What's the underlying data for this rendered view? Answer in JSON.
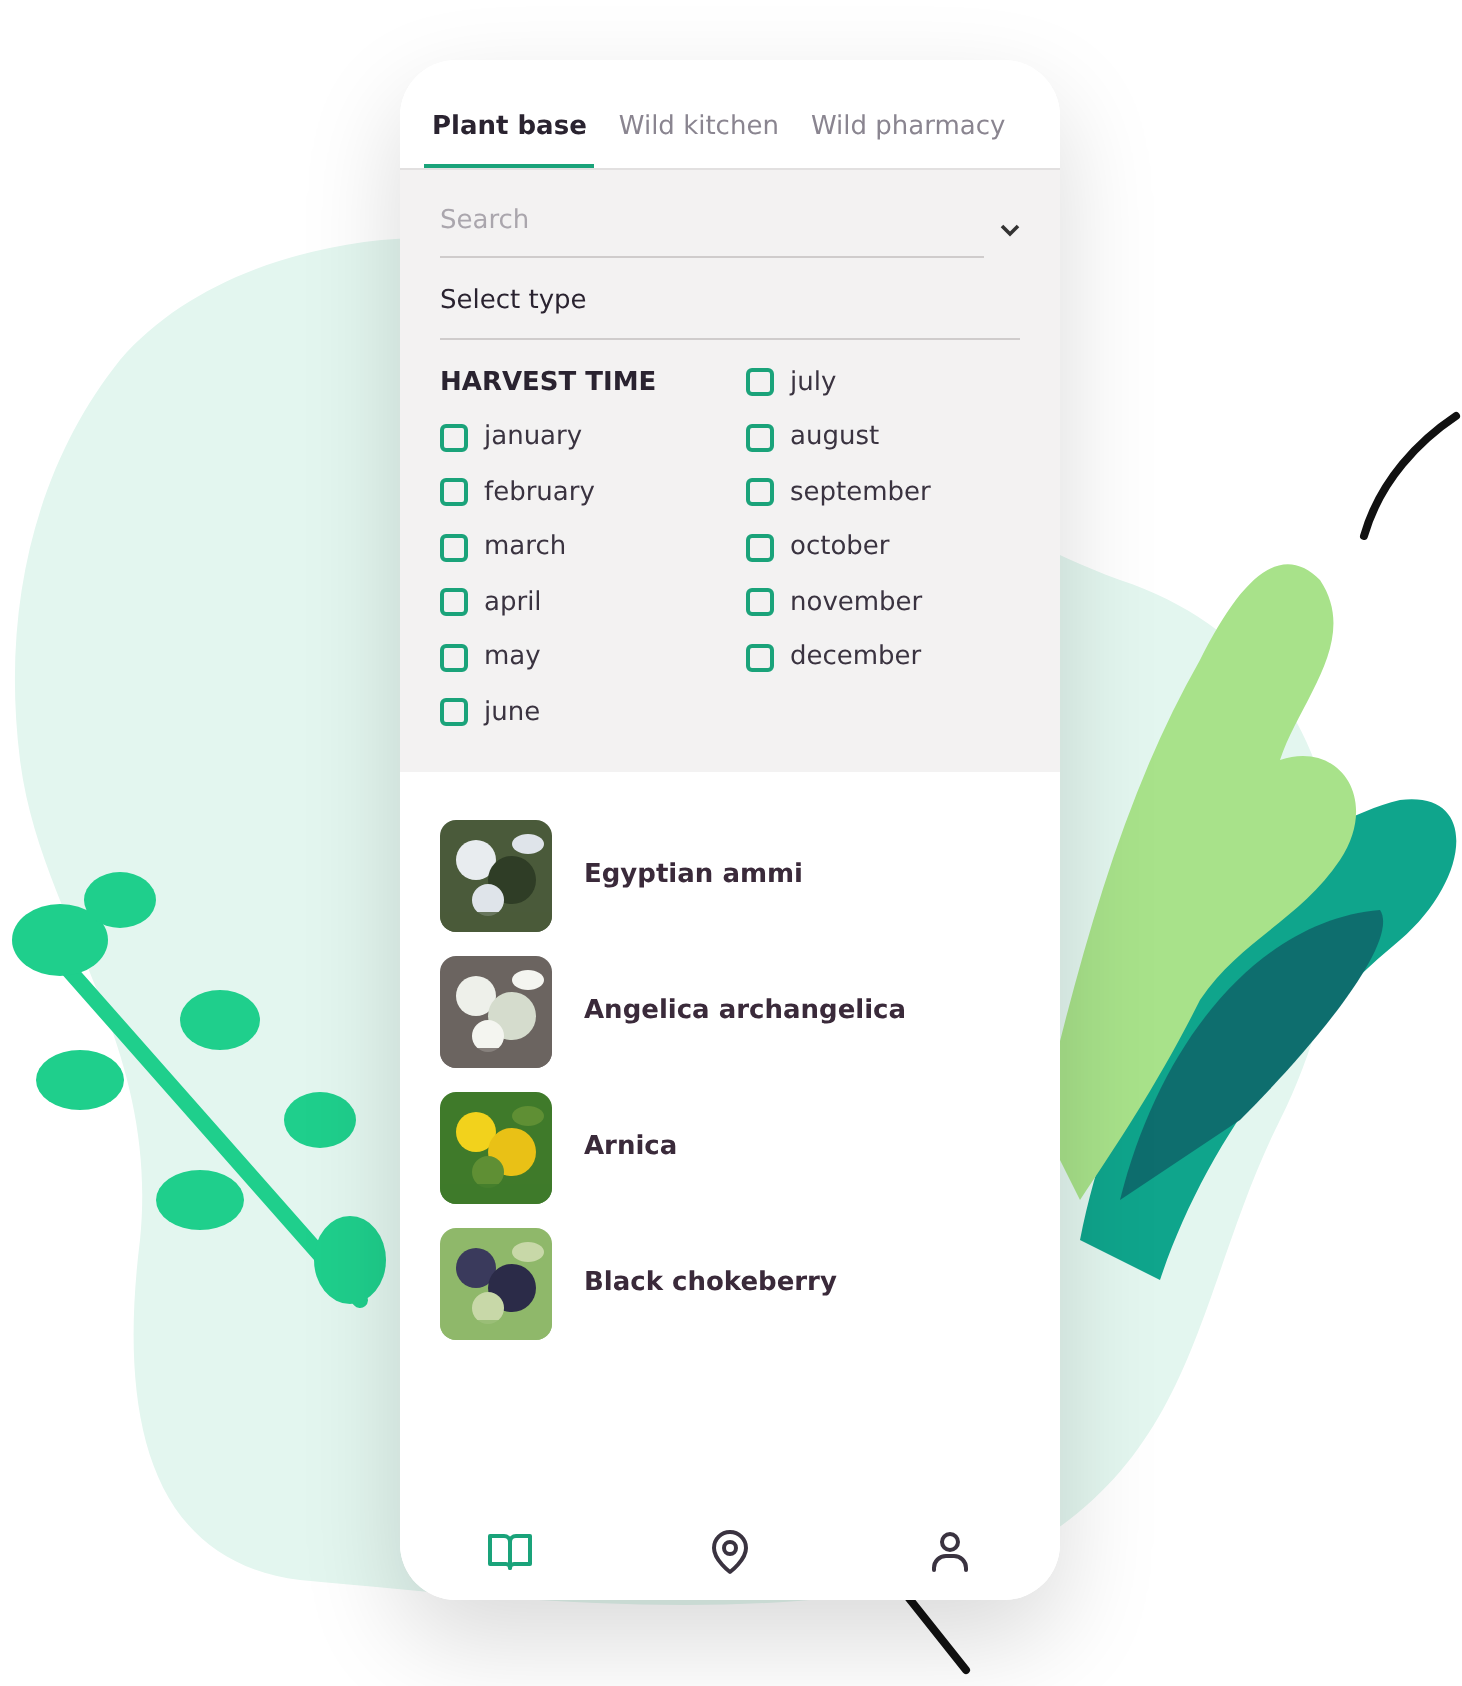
{
  "tabs": [
    {
      "label": "Plant base",
      "selected": true
    },
    {
      "label": "Wild kitchen",
      "selected": false
    },
    {
      "label": "Wild pharmacy",
      "selected": false
    }
  ],
  "search": {
    "placeholder": "Search"
  },
  "type_select": {
    "label": "Select type"
  },
  "harvest_time": {
    "title": "HARVEST TIME",
    "months": [
      {
        "label": "january",
        "checked": false
      },
      {
        "label": "february",
        "checked": false
      },
      {
        "label": "march",
        "checked": false
      },
      {
        "label": "april",
        "checked": false
      },
      {
        "label": "may",
        "checked": false
      },
      {
        "label": "june",
        "checked": false
      },
      {
        "label": "july",
        "checked": false
      },
      {
        "label": "august",
        "checked": false
      },
      {
        "label": "september",
        "checked": false
      },
      {
        "label": "october",
        "checked": false
      },
      {
        "label": "november",
        "checked": false
      },
      {
        "label": "december",
        "checked": false
      }
    ]
  },
  "plants": [
    {
      "name": "Egyptian ammi",
      "kind": "picture"
    },
    {
      "name": "Angelica archangelica",
      "kind": "picture"
    },
    {
      "name": "Arnica",
      "kind": "picture"
    },
    {
      "name": "Black chokeberry",
      "kind": "picture"
    }
  ],
  "nav": [
    {
      "kind": "book",
      "selected": true
    },
    {
      "kind": "pin",
      "selected": false
    },
    {
      "kind": "person",
      "selected": false
    }
  ]
}
